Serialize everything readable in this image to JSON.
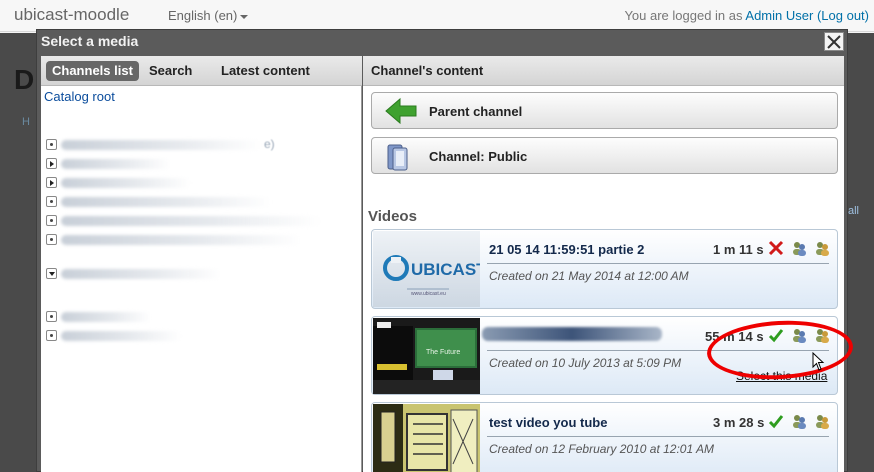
{
  "navbar": {
    "brand": "ubicast-moodle",
    "language": "English (en)",
    "login_prefix": "You are logged in as ",
    "user": "Admin User",
    "logout": "(Log out)"
  },
  "background": {
    "heading_letter": "D",
    "bits_right": "all",
    "bits_left": "H"
  },
  "modal": {
    "title": "Select a media",
    "tabs": [
      "Channels list",
      "Search",
      "Latest content"
    ],
    "right_header": "Channel's content",
    "catalog_root": "Catalog root",
    "tree_blur_label": "e)",
    "parent_channel": "Parent channel",
    "current_channel": "Channel: Public",
    "videos_heading": "Videos",
    "select_label": "Select this media",
    "videos": [
      {
        "title": "21 05 14 11:59:51 partie 2",
        "duration": "1 m 11 s",
        "created": "Created on 21 May 2014 at 12:00 AM",
        "status": "cross",
        "thumb_text": "UBICAST",
        "thumb_sub": "www.ubicast.eu"
      },
      {
        "title": "",
        "duration": "55 m 14 s",
        "created": "Created on 10 July 2013 at 5:09 PM",
        "status": "check",
        "thumb_text": "The Future"
      },
      {
        "title": "test video you tube",
        "duration": "3 m 28 s",
        "created": "Created on 12 February 2010 at 12:01 AM",
        "status": "check"
      }
    ]
  },
  "colors": {
    "accent": "#0a4c9c",
    "highlight": "#e00000",
    "check": "#2e9d1f",
    "cross": "#d11a1a"
  }
}
